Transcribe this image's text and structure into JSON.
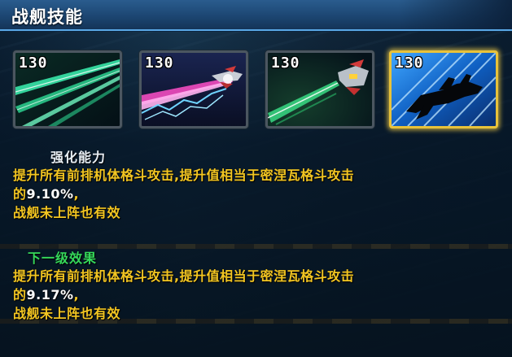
{
  "header": {
    "title": "战舰技能"
  },
  "skills": [
    {
      "level": "130",
      "icon": "green-laser-beams-icon",
      "selected": false
    },
    {
      "level": "130",
      "icon": "pink-lightning-ship-icon",
      "selected": false
    },
    {
      "level": "130",
      "icon": "green-beam-fighter-icon",
      "selected": false
    },
    {
      "level": "130",
      "icon": "warship-silhouette-icon",
      "selected": true
    }
  ],
  "current": {
    "title": "强化能力",
    "line1": "提升所有前排机体格斗攻击,提升值相当于密涅瓦格斗攻击",
    "line2_prefix": "的",
    "line2_value": "9.10%",
    "line2_suffix": ",",
    "line3": "战舰未上阵也有效"
  },
  "next": {
    "title": "下一级效果",
    "line1": "提升所有前排机体格斗攻击,提升值相当于密涅瓦格斗攻击",
    "line2_prefix": "的",
    "line2_value": "9.17%",
    "line2_suffix": ",",
    "line3": "战舰未上阵也有效"
  },
  "colors": {
    "current_title": "#e8eef4",
    "next_title": "#35d85a",
    "desc": "#f3c622",
    "selected_border": "#e8c23a"
  }
}
